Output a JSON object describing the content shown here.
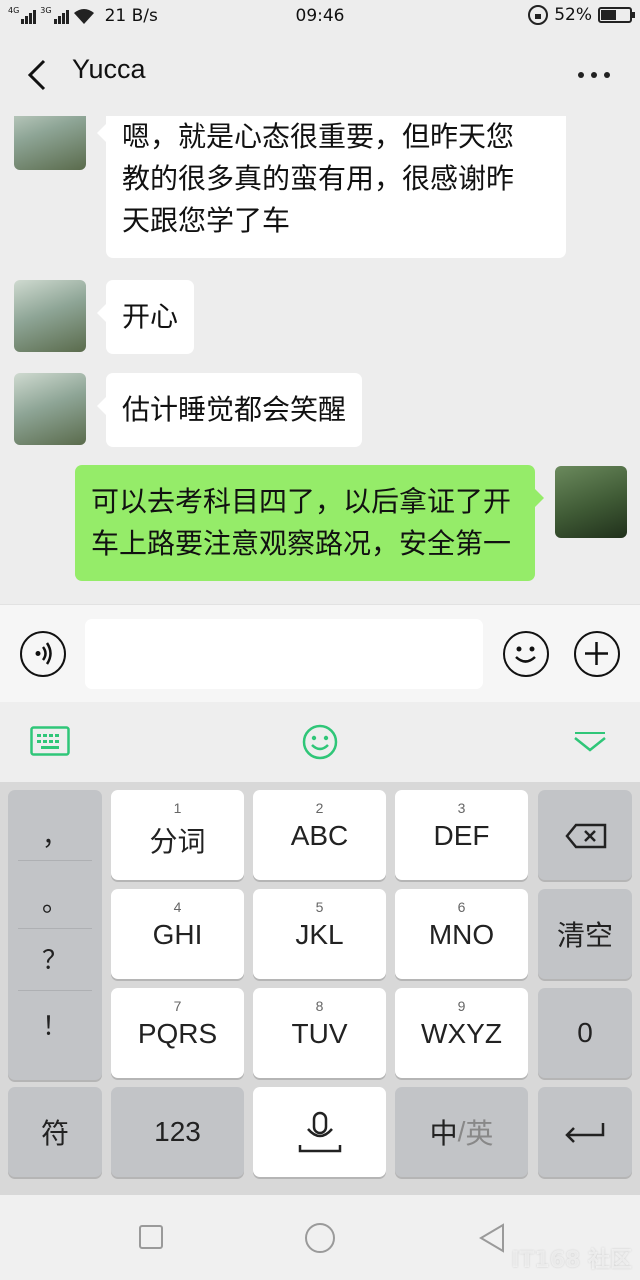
{
  "status_bar": {
    "network_top": "4G",
    "network_bottom": "3G",
    "speed": "21 B/s",
    "time": "09:46",
    "battery": "52%",
    "battery_level": 0.52
  },
  "header": {
    "title": "Yucca"
  },
  "messages": [
    {
      "sender": "contact",
      "text": "嗯，就是心态很重要，但昨天您教的很多真的蛮有用，很感谢昨天跟您学了车"
    },
    {
      "sender": "contact",
      "text": "开心"
    },
    {
      "sender": "contact",
      "text": "估计睡觉都会笑醒"
    },
    {
      "sender": "me",
      "text": "可以去考科目四了，以后拿证了开车上路要注意观察路况，安全第一"
    }
  ],
  "message_lines": {
    "m0": [
      "嗯，就是心态很重要，但昨天您",
      "教的很多真的蛮有用，很感谢昨",
      "天跟您学了车"
    ],
    "m3": [
      "可以去考科目四了，以后拿证了开",
      "车上路要注意观察路况，安全第一"
    ]
  },
  "input": {
    "value": "",
    "placeholder": ""
  },
  "keyboard": {
    "punctuation": [
      "，",
      "。",
      "？",
      "！"
    ],
    "keys": [
      {
        "num": "1",
        "label": "分词"
      },
      {
        "num": "2",
        "label": "ABC"
      },
      {
        "num": "3",
        "label": "DEF"
      },
      {
        "num": "4",
        "label": "GHI"
      },
      {
        "num": "5",
        "label": "JKL"
      },
      {
        "num": "6",
        "label": "MNO"
      },
      {
        "num": "7",
        "label": "PQRS"
      },
      {
        "num": "8",
        "label": "TUV"
      },
      {
        "num": "9",
        "label": "WXYZ"
      }
    ],
    "clear": "清空",
    "zero": "0",
    "symbols": "符",
    "numbers": "123",
    "lang_zh": "中",
    "lang_sep": "/",
    "lang_en": "英"
  },
  "watermark": "IT168 社区",
  "colors": {
    "my_bubble": "#95ec69",
    "accent_green": "#2fc678"
  }
}
